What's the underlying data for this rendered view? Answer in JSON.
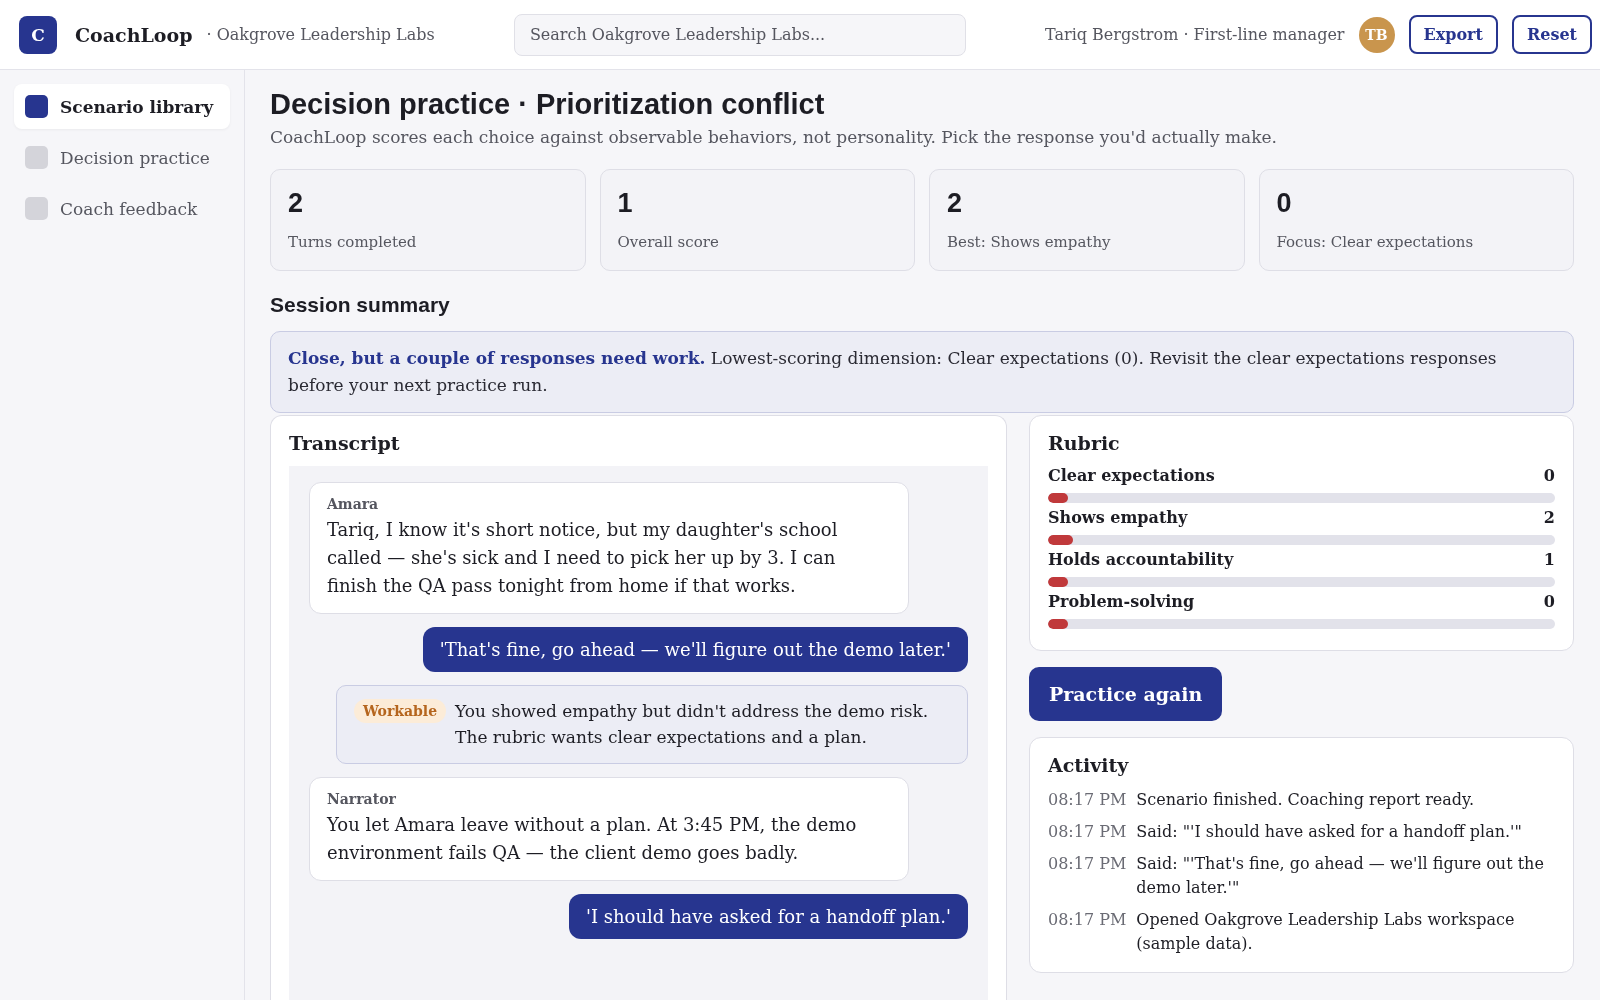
{
  "app": {
    "logo_letter": "C",
    "name": "CoachLoop",
    "workspace": "· Oakgrove Leadership Labs"
  },
  "search": {
    "placeholder": "Search Oakgrove Leadership Labs..."
  },
  "user": {
    "label": "Tariq Bergstrom · First-line manager",
    "initials": "TB"
  },
  "header_buttons": [
    "Export",
    "Reset"
  ],
  "sidebar": {
    "items": [
      {
        "label": "Scenario library",
        "selected": true
      },
      {
        "label": "Decision practice",
        "selected": false
      },
      {
        "label": "Coach feedback",
        "selected": false
      }
    ]
  },
  "page": {
    "title": "Decision practice · Prioritization conflict",
    "subtitle": "CoachLoop scores each choice against observable behaviors, not personality. Pick the response you'd actually make."
  },
  "stats": [
    {
      "value": "2",
      "label": "Turns completed"
    },
    {
      "value": "1",
      "label": "Overall score"
    },
    {
      "value": "2",
      "label": "Best: Shows empathy"
    },
    {
      "value": "0",
      "label": "Focus: Clear expectations"
    }
  ],
  "session_summary": {
    "heading": "Session summary",
    "text": "**Close, but a couple of responses need work.** Lowest-scoring dimension: Clear expectations (0). Revisit the clear expectations responses before your next practice run."
  },
  "transcript": {
    "title": "Transcript",
    "messages": [
      {
        "kind": "character",
        "speaker": "Amara",
        "text": "Tariq, I know it's short notice, but my daughter's school called — she's sick and I need to pick her up by 3. I can finish the QA pass tonight from home if that works."
      },
      {
        "kind": "response",
        "text": "'That's fine, go ahead — we'll figure out the demo later.'"
      },
      {
        "kind": "feedback",
        "badge": "Workable",
        "text": "You showed empathy but didn't address the demo risk. The rubric wants clear expectations and a plan."
      },
      {
        "kind": "character",
        "speaker": "Narrator",
        "text": "You let Amara leave without a plan. At 3:45 PM, the demo environment fails QA — the client demo goes badly."
      },
      {
        "kind": "response",
        "text": "'I should have asked for a handoff plan.'"
      }
    ]
  },
  "rubric": {
    "title": "Rubric",
    "items": [
      {
        "label": "Clear expectations",
        "score": "0",
        "level": 0.04
      },
      {
        "label": "Shows empathy",
        "score": "2",
        "level": 0.05
      },
      {
        "label": "Holds accountability",
        "score": "1",
        "level": 0.04
      },
      {
        "label": "Problem-solving",
        "score": "0",
        "level": 0.04
      }
    ]
  },
  "practice_button": "Practice again",
  "activity": {
    "title": "Activity",
    "entries": [
      {
        "time": "08:17 PM",
        "text": "Scenario finished. Coaching report ready."
      },
      {
        "time": "08:17 PM",
        "text": "Said: \"'I should have asked for a handoff plan.'\""
      },
      {
        "time": "08:17 PM",
        "text": "Said: \"'That's fine, go ahead — we'll figure out the demo later.'\""
      },
      {
        "time": "08:17 PM",
        "text": "Opened Oakgrove Leadership Labs workspace (sample data)."
      }
    ]
  }
}
